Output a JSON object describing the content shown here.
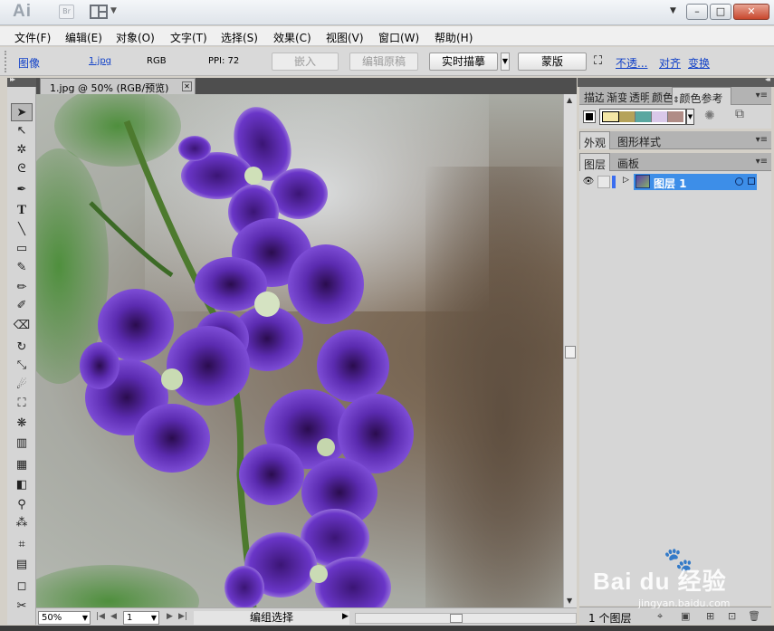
{
  "window": {
    "logo": "Ai",
    "bridge_label": "Br",
    "buttons": {
      "minimize": "–",
      "maximize": "□",
      "close": "✕"
    }
  },
  "menu": [
    "文件(F)",
    "编辑(E)",
    "对象(O)",
    "文字(T)",
    "选择(S)",
    "效果(C)",
    "视图(V)",
    "窗口(W)",
    "帮助(H)"
  ],
  "control_bar": {
    "object_type": "图像",
    "filename": "1.jpg",
    "color_mode": "RGB",
    "ppi": "PPI: 72",
    "embed_label": "嵌入",
    "edit_original_label": "编辑原稿",
    "live_trace_label": "实时描摹",
    "mask_label": "蒙版",
    "opacity_link": "不透...",
    "align_link": "对齐",
    "transform_link": "变换"
  },
  "document": {
    "tab_title": "1.jpg @ 50% (RGB/预览)",
    "tab_close": "✕"
  },
  "status_bar": {
    "zoom": "50%",
    "page": "1",
    "status_text": "编组选择"
  },
  "panels": {
    "top_tabs": [
      "描边",
      "渐变",
      "透明",
      "颜色",
      "颜色参考"
    ],
    "appearance_tabs": [
      "外观",
      "图形样式"
    ],
    "layers_tabs": [
      "图层",
      "画板"
    ],
    "layer_name": "图层 1",
    "layer_count": "1 个图层",
    "harmony_colors": [
      "#f3e6a6",
      "#b5a25a",
      "#5aa7a0",
      "#d9c8e9",
      "#b08c86"
    ]
  },
  "watermark": {
    "brand": "Bai du 经验",
    "url": "jingyan.baidu.com"
  }
}
